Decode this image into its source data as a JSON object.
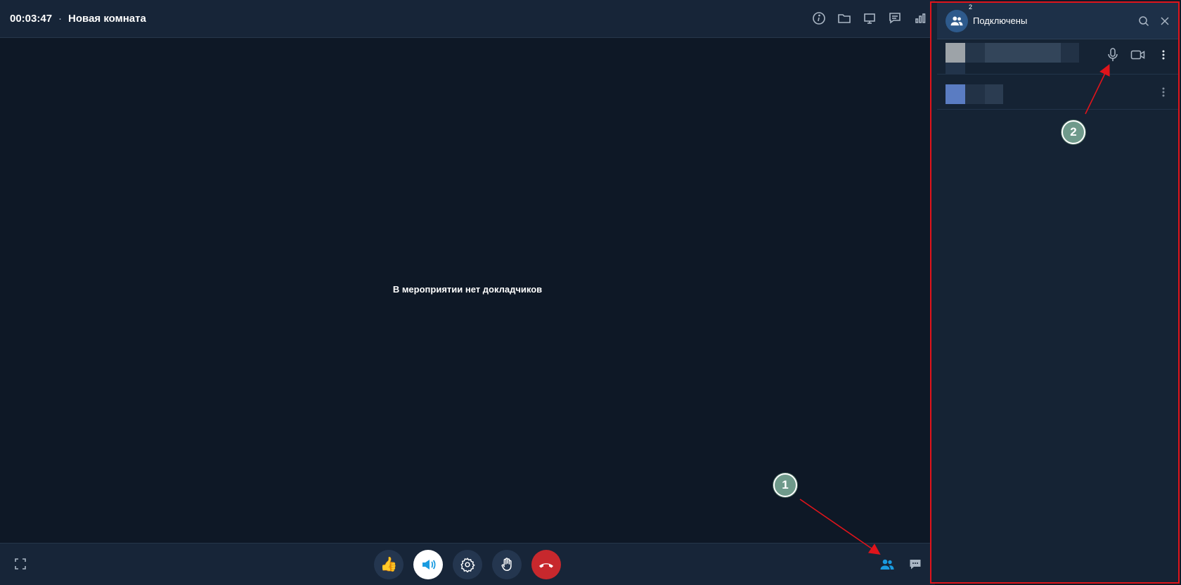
{
  "header": {
    "timer": "00:03:47",
    "separator": "·",
    "room_name": "Новая комната"
  },
  "stage": {
    "message": "В мероприятии нет докладчиков"
  },
  "top_icons": [
    "info-icon",
    "folder-icon",
    "screen-share-icon",
    "chat-icon",
    "stats-icon"
  ],
  "controls": [
    {
      "name": "like-icon",
      "glyph": "👍"
    },
    {
      "name": "speaker-icon"
    },
    {
      "name": "settings-icon"
    },
    {
      "name": "raise-hand-icon"
    },
    {
      "name": "hangup-icon"
    }
  ],
  "panel": {
    "title": "Подключены",
    "participant_count": "2"
  },
  "callouts": {
    "one": "1",
    "two": "2"
  },
  "colors": {
    "accent": "#1a9be0",
    "hangup": "#c7282d",
    "highlight_border": "#e0141b",
    "callout": "#6f9a8b"
  }
}
